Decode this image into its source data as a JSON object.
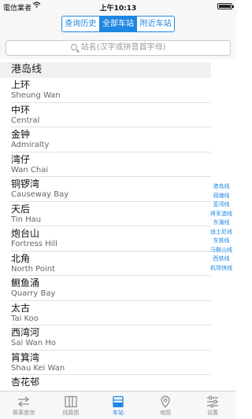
{
  "status_bar": {
    "carrier": "電信業者",
    "time": "上午10:13"
  },
  "segmented": [
    {
      "label": "查询历史",
      "active": false
    },
    {
      "label": "全部车站",
      "active": true
    },
    {
      "label": "附近车站",
      "active": false
    }
  ],
  "search": {
    "placeholder": "站名(汉字或拼音首字母)"
  },
  "section": {
    "title": "港岛线"
  },
  "stations": [
    {
      "zh": "上环",
      "en": "Sheung Wan"
    },
    {
      "zh": "中环",
      "en": "Central"
    },
    {
      "zh": "金钟",
      "en": "Admiralty"
    },
    {
      "zh": "湾仔",
      "en": "Wan Chai"
    },
    {
      "zh": "铜锣湾",
      "en": "Causeway Bay"
    },
    {
      "zh": "天后",
      "en": "Tin Hau"
    },
    {
      "zh": "炮台山",
      "en": "Fortress Hill"
    },
    {
      "zh": "北角",
      "en": "North Point"
    },
    {
      "zh": "鲗鱼涌",
      "en": "Quarry Bay"
    },
    {
      "zh": "太古",
      "en": "Tai Koo"
    },
    {
      "zh": "西湾河",
      "en": "Sai Wan Ho"
    },
    {
      "zh": "筲箕湾",
      "en": "Shau Kei Wan"
    },
    {
      "zh": "杏花邨",
      "en": ""
    }
  ],
  "index_items": [
    "港岛线",
    "观塘线",
    "荃湾线",
    "将军澳线",
    "东涌线",
    "迪士尼线",
    "东铁线",
    "马鞍山线",
    "西铁线",
    "机场快线"
  ],
  "tabs": [
    {
      "label": "换乘查询",
      "icon": "transfer-icon",
      "active": false
    },
    {
      "label": "线路图",
      "icon": "map-book-icon",
      "active": false
    },
    {
      "label": "车站",
      "icon": "station-icon",
      "active": true
    },
    {
      "label": "地图",
      "icon": "location-pin-icon",
      "active": false
    },
    {
      "label": "设置",
      "icon": "settings-sliders-icon",
      "active": false
    }
  ],
  "colors": {
    "accent": "#1e87e3"
  }
}
